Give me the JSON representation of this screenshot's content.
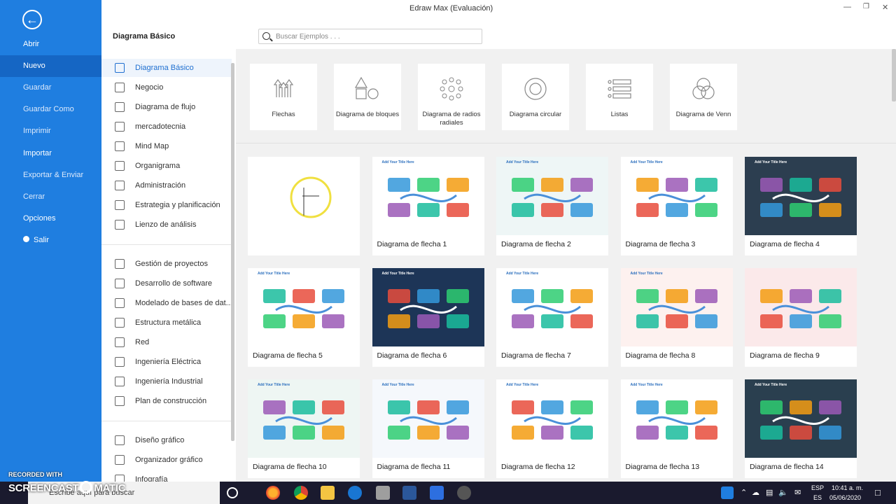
{
  "window": {
    "title": "Edraw Max (Evaluación)"
  },
  "nav": {
    "items": [
      {
        "label": "Abrir",
        "strong": true
      },
      {
        "label": "Nuevo",
        "strong": true,
        "active": true
      },
      {
        "label": "Guardar",
        "strong": false
      },
      {
        "label": "Guardar Como",
        "strong": false
      },
      {
        "label": "Imprimir",
        "strong": false
      },
      {
        "label": "Importar",
        "strong": true
      },
      {
        "label": "Exportar & Enviar",
        "strong": false
      },
      {
        "label": "Cerrar",
        "strong": false
      },
      {
        "label": "Opciones",
        "strong": true
      },
      {
        "label": "Salir",
        "strong": true
      }
    ]
  },
  "header": {
    "section_title": "Diagrama Básico",
    "search_placeholder": "Buscar Ejemplos . . ."
  },
  "categories": {
    "group1": [
      "Diagrama Básico",
      "Negocio",
      "Diagrama de flujo",
      "mercadotecnia",
      "Mind Map",
      "Organigrama",
      "Administración",
      "Estrategia y planificación",
      "Lienzo de análisis"
    ],
    "group2": [
      "Gestión de proyectos",
      "Desarrollo de software",
      "Modelado de bases de dat...",
      "Estructura metálica",
      "Red",
      "Ingeniería Eléctrica",
      "Ingeniería Industrial",
      "Plan de construcción"
    ],
    "group3": [
      "Diseño gráfico",
      "Organizador gráfico",
      "Infografía"
    ]
  },
  "diagram_types": [
    {
      "label": "Flechas",
      "icon": "arrows-icon"
    },
    {
      "label": "Diagrama de bloques",
      "icon": "blocks-icon"
    },
    {
      "label": "Diagrama de radios radiales",
      "icon": "radial-icon"
    },
    {
      "label": "Diagrama circular",
      "icon": "circular-icon"
    },
    {
      "label": "Listas",
      "icon": "list-icon"
    },
    {
      "label": "Diagrama de Venn",
      "icon": "venn-icon"
    }
  ],
  "templates": [
    {
      "label": "",
      "bg": "#ffffff",
      "thumb_title": ""
    },
    {
      "label": "Diagrama de flecha 1",
      "bg": "#ffffff",
      "thumb_title": "Add Your Title Here"
    },
    {
      "label": "Diagrama de flecha 2",
      "bg": "#eef6f6",
      "thumb_title": "Add Your Title Here"
    },
    {
      "label": "Diagrama de flecha 3",
      "bg": "#ffffff",
      "thumb_title": "Add Your Title Here"
    },
    {
      "label": "Diagrama de flecha 4",
      "bg": "#2c3e50",
      "thumb_title": "Add Your Title Here"
    },
    {
      "label": "Diagrama de flecha 5",
      "bg": "#ffffff",
      "thumb_title": "Add Your Title Here"
    },
    {
      "label": "Diagrama de flecha 6",
      "bg": "#1d3557",
      "thumb_title": "Add Your Title Here"
    },
    {
      "label": "Diagrama de flecha 7",
      "bg": "#ffffff",
      "thumb_title": "Add Your Title Here"
    },
    {
      "label": "Diagrama de flecha 8",
      "bg": "#fdf1ef",
      "thumb_title": "Add Your Title Here"
    },
    {
      "label": "Diagrama de flecha 9",
      "bg": "#fbe9ea",
      "thumb_title": ""
    },
    {
      "label": "Diagrama de flecha 10",
      "bg": "#eef6f3",
      "thumb_title": "Add Your Title Here"
    },
    {
      "label": "Diagrama de flecha 11",
      "bg": "#f5f8fc",
      "thumb_title": "Add Your Title Here"
    },
    {
      "label": "Diagrama de flecha 12",
      "bg": "#ffffff",
      "thumb_title": "Add Your Title Here"
    },
    {
      "label": "Diagrama de flecha 13",
      "bg": "#ffffff",
      "thumb_title": "Add Your Title Here"
    },
    {
      "label": "Diagrama de flecha 14",
      "bg": "#2a3f4f",
      "thumb_title": "Add Your Title Here"
    }
  ],
  "taskbar": {
    "search_placeholder": "Escribe aquí para buscar",
    "recorded_with": "RECORDED WITH",
    "screencast": "SCREENCAST",
    "matic": "MATIC",
    "lang_top": "ESP",
    "lang_bottom": "ES",
    "time": "10:41 a. m.",
    "date": "05/06/2020"
  },
  "colors": {
    "accent": "#1f7ee0",
    "nav_active": "#1566c4"
  }
}
